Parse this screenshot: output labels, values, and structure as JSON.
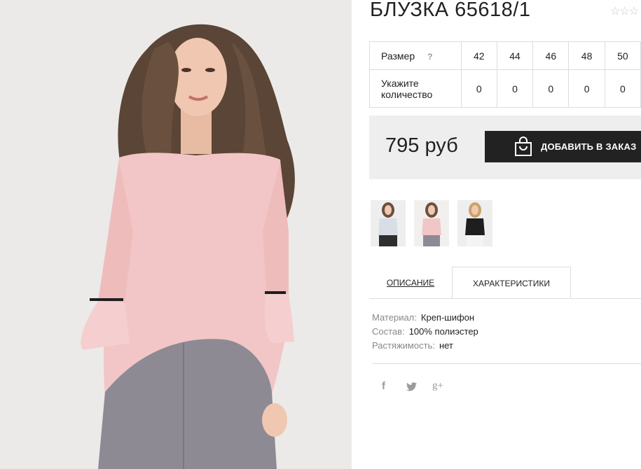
{
  "product": {
    "title": "БЛУЗКА 65618/1",
    "rating_stars": "☆☆☆"
  },
  "sizes": {
    "size_label": "Размер",
    "help_mark": "?",
    "qty_label": "Укажите количество",
    "values": [
      "42",
      "44",
      "46",
      "48",
      "50"
    ],
    "quantities": [
      "0",
      "0",
      "0",
      "0",
      "0"
    ]
  },
  "order": {
    "price": "795 руб",
    "button_label": "ДОБАВИТЬ В ЗАКАЗ"
  },
  "tabs": {
    "description": "ОПИСАНИЕ",
    "characteristics": "ХАРАКТЕРИСТИКИ"
  },
  "characteristics": [
    {
      "key": "Материал:",
      "value": "Креп-шифон"
    },
    {
      "key": "Состав:",
      "value": "100% полиэстер"
    },
    {
      "key": "Растяжимость:",
      "value": "нет"
    }
  ],
  "social": {
    "facebook": "f",
    "twitter": "twitter-icon",
    "gplus": "g+"
  },
  "colors": {
    "button_bg": "#222222",
    "price_box_bg": "#eeeeee",
    "blouse": "#f2c6c6",
    "pants": "#8d8a94"
  },
  "thumbnails": [
    {
      "icon": "model-light-blouse-image"
    },
    {
      "icon": "model-pink-blouse-image"
    },
    {
      "icon": "model-black-blouse-image"
    }
  ]
}
